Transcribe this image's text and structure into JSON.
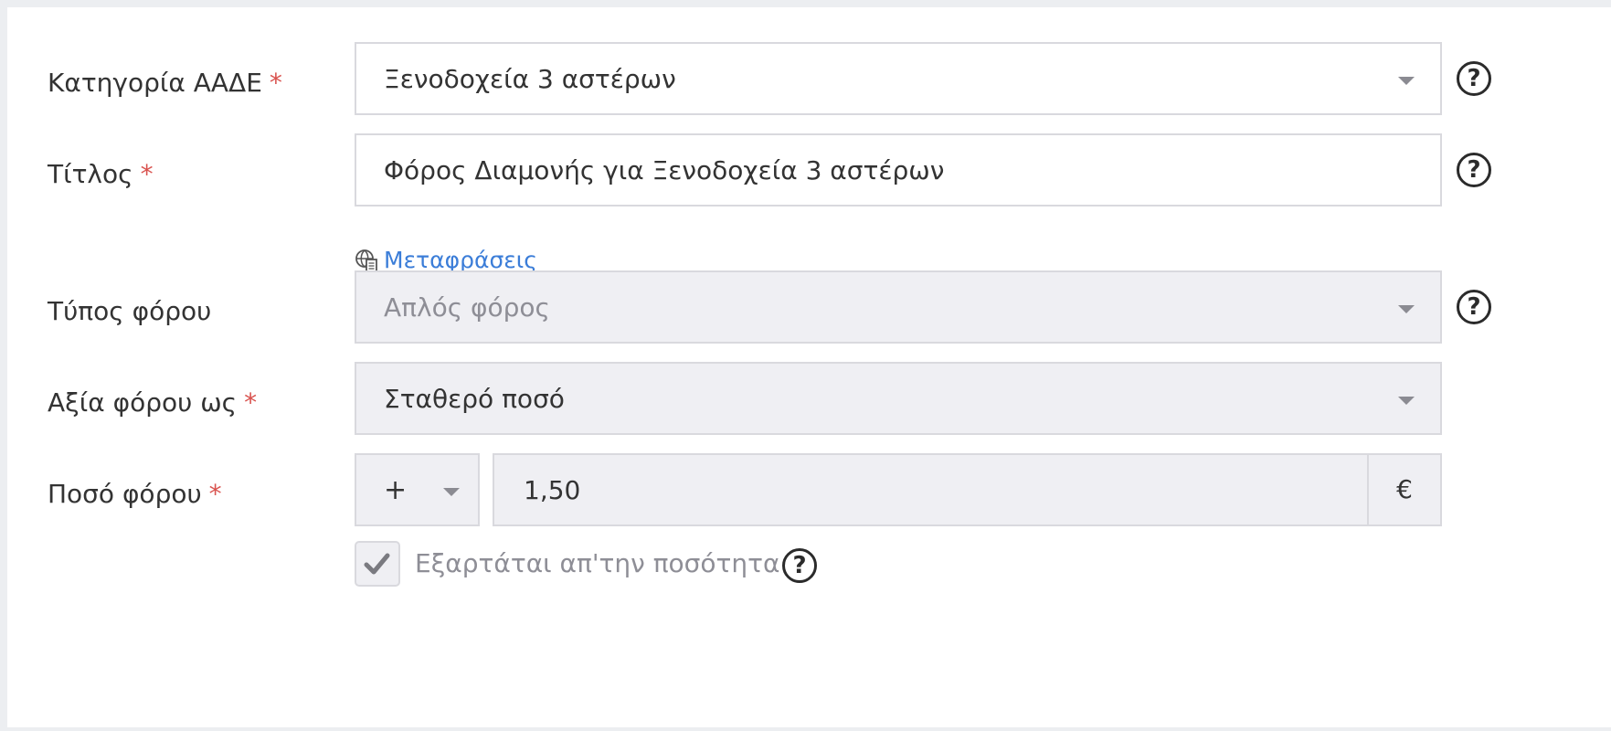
{
  "form": {
    "category": {
      "label": "Κατηγορία ΑΑΔΕ",
      "required_mark": "*",
      "value": "Ξενοδοχεία 3 αστέρων"
    },
    "title": {
      "label": "Τίτλος",
      "required_mark": "*",
      "value": "Φόρος Διαμονής για Ξενοδοχεία 3 αστέρων"
    },
    "translations_link": "Μεταφράσεις",
    "tax_type": {
      "label": "Τύπος φόρου",
      "value": "Απλός φόρος",
      "disabled": true
    },
    "tax_value_as": {
      "label": "Αξία φόρου ως",
      "required_mark": "*",
      "value": "Σταθερό ποσό"
    },
    "tax_amount": {
      "label": "Ποσό φόρου",
      "required_mark": "*",
      "sign": "+",
      "value": "1,50",
      "currency": "€"
    },
    "depends_on_quantity": {
      "label": "Εξαρτάται απ'την ποσότητα",
      "checked": true
    },
    "help_glyph": "?"
  },
  "icons": {
    "help": "question-circle-icon",
    "translations": "globe-document-icon",
    "dropdown": "caret-down-icon",
    "check": "checkmark-icon"
  },
  "colors": {
    "required": "#d9534f",
    "link": "#3b7dd8",
    "disabled_bg": "#efeff3",
    "border": "#d9d9de"
  }
}
